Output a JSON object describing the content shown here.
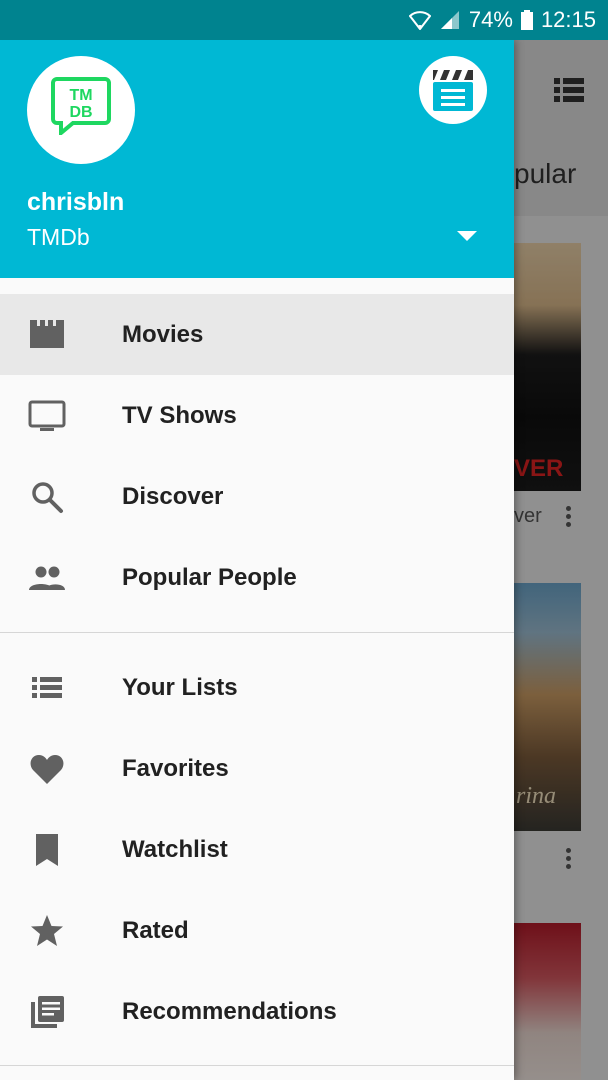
{
  "status_bar": {
    "battery": "74%",
    "time": "12:15",
    "icons": [
      "wifi-icon",
      "signal-icon",
      "battery-icon"
    ]
  },
  "background_app": {
    "title_fragment": "pular",
    "caption_fragment": "ver",
    "poster1_text": "VER",
    "poster2_text": "rina"
  },
  "drawer": {
    "header": {
      "logo_text": [
        "TM",
        "DB"
      ],
      "username": "chrisbln",
      "account": "TMDb",
      "clapper_icon": "clapperboard-icon"
    },
    "primary_items": [
      {
        "label": "Movies",
        "icon": "movie-icon",
        "active": true
      },
      {
        "label": "TV Shows",
        "icon": "tv-icon"
      },
      {
        "label": "Discover",
        "icon": "search-icon"
      },
      {
        "label": "Popular People",
        "icon": "people-icon"
      }
    ],
    "secondary_items": [
      {
        "label": "Your Lists",
        "icon": "list-icon"
      },
      {
        "label": "Favorites",
        "icon": "heart-icon"
      },
      {
        "label": "Watchlist",
        "icon": "bookmark-icon"
      },
      {
        "label": "Rated",
        "icon": "star-icon"
      },
      {
        "label": "Recommendations",
        "icon": "recommendations-icon"
      }
    ]
  },
  "colors": {
    "header": "#00b8d4",
    "status_bar": "#00838f",
    "logo_green": "#1ed760",
    "icon_gray": "#616161"
  }
}
